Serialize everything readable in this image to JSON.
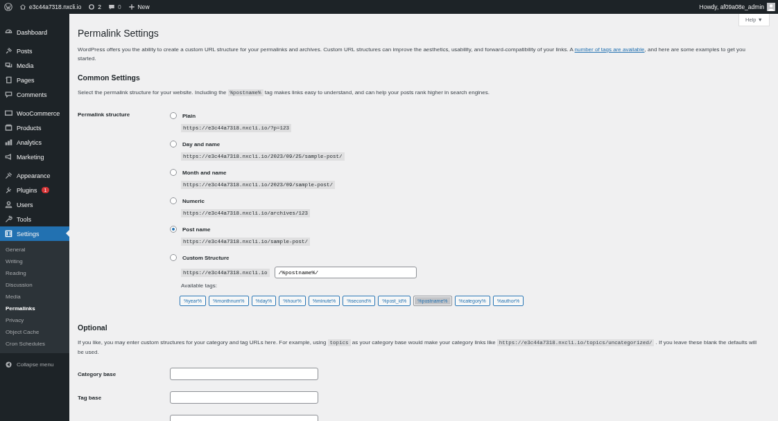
{
  "admin_bar": {
    "site": "e3c44a7318.nxcli.io",
    "updates": "2",
    "comments": "0",
    "new": "New",
    "howdy": "Howdy, af09a08e_admin"
  },
  "sidebar": {
    "sections": [
      [
        {
          "label": "Dashboard",
          "selected": false
        }
      ],
      [
        {
          "label": "Posts",
          "selected": false
        },
        {
          "label": "Media",
          "selected": false
        },
        {
          "label": "Pages",
          "selected": false
        },
        {
          "label": "Comments",
          "selected": false
        }
      ],
      [
        {
          "label": "WooCommerce",
          "selected": false
        },
        {
          "label": "Products",
          "selected": false
        },
        {
          "label": "Analytics",
          "selected": false
        },
        {
          "label": "Marketing",
          "selected": false
        }
      ],
      [
        {
          "label": "Appearance",
          "selected": false
        },
        {
          "label": "Plugins",
          "selected": false,
          "badge": "1"
        },
        {
          "label": "Users",
          "selected": false
        },
        {
          "label": "Tools",
          "selected": false
        },
        {
          "label": "Settings",
          "selected": true,
          "children": [
            {
              "label": "General",
              "selected": false
            },
            {
              "label": "Writing",
              "selected": false
            },
            {
              "label": "Reading",
              "selected": false
            },
            {
              "label": "Discussion",
              "selected": false
            },
            {
              "label": "Media",
              "selected": false
            },
            {
              "label": "Permalinks",
              "selected": true
            },
            {
              "label": "Privacy",
              "selected": false
            },
            {
              "label": "Object Cache",
              "selected": false
            },
            {
              "label": "Cron Schedules",
              "selected": false
            }
          ]
        }
      ]
    ],
    "collapse": "Collapse menu"
  },
  "help": "Help ▼",
  "title": "Permalink Settings",
  "intro": [
    {
      "kind": "text",
      "text": "WordPress offers you the ability to create a custom URL structure for your permalinks and archives. Custom URL structures can improve the aesthetics, usability, and forward-compatibility of your links. A "
    },
    {
      "kind": "link",
      "text": "number of tags are available"
    },
    {
      "kind": "text",
      "text": ", and here are some examples to get you started."
    }
  ],
  "common": {
    "heading": "Common Settings",
    "description": [
      {
        "kind": "text",
        "text": "Select the permalink structure for your website. Including the "
      },
      {
        "kind": "code",
        "text": "%postname%"
      },
      {
        "kind": "text",
        "text": " tag makes links easy to understand, and can help your posts rank higher in search engines."
      }
    ],
    "label": "Permalink structure",
    "options": [
      {
        "label": "Plain",
        "example": "https://e3c44a7318.nxcli.io/?p=123",
        "selected": false
      },
      {
        "label": "Day and name",
        "example": "https://e3c44a7318.nxcli.io/2023/09/25/sample-post/",
        "selected": false
      },
      {
        "label": "Month and name",
        "example": "https://e3c44a7318.nxcli.io/2023/09/sample-post/",
        "selected": false
      },
      {
        "label": "Numeric",
        "example": "https://e3c44a7318.nxcli.io/archives/123",
        "selected": false
      },
      {
        "label": "Post name",
        "example": "https://e3c44a7318.nxcli.io/sample-post/",
        "selected": true
      },
      {
        "label": "Custom Structure",
        "selected": false
      }
    ],
    "custom_prefix": "https://e3c44a7318.nxcli.io",
    "custom_value": "/%postname%/",
    "tags_label": "Available tags:",
    "tags": [
      {
        "label": "%year%",
        "selected": false
      },
      {
        "label": "%monthnum%",
        "selected": false
      },
      {
        "label": "%day%",
        "selected": false
      },
      {
        "label": "%hour%",
        "selected": false
      },
      {
        "label": "%minute%",
        "selected": false
      },
      {
        "label": "%second%",
        "selected": false
      },
      {
        "label": "%post_id%",
        "selected": false
      },
      {
        "label": "%postname%",
        "selected": true
      },
      {
        "label": "%category%",
        "selected": false
      },
      {
        "label": "%author%",
        "selected": false
      }
    ]
  },
  "optional": {
    "heading": "Optional",
    "description": [
      {
        "kind": "text",
        "text": "If you like, you may enter custom structures for your category and tag URLs here. For example, using "
      },
      {
        "kind": "code",
        "text": "topics"
      },
      {
        "kind": "text",
        "text": " as your category base would make your category links like "
      },
      {
        "kind": "code",
        "text": "https://e3c44a7318.nxcli.io/topics/uncategorized/"
      },
      {
        "kind": "text",
        "text": " . If you leave these blank the defaults will be used."
      }
    ],
    "fields": [
      {
        "kind": "labeled",
        "label": "Category base"
      },
      {
        "kind": "labeled",
        "label": "Tag base"
      },
      {
        "kind": "unlabeled"
      }
    ]
  }
}
